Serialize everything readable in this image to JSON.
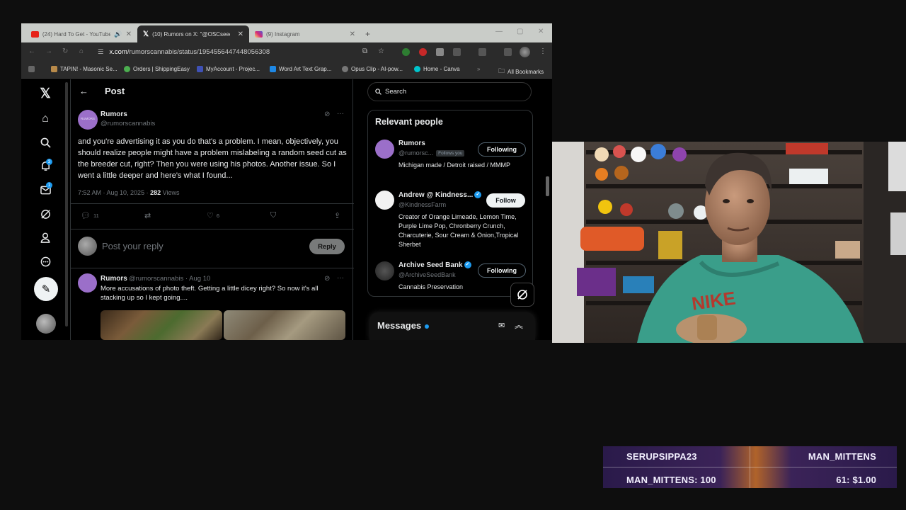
{
  "browser": {
    "tabs": [
      {
        "title": "(24) Hard To Get - YouTube",
        "favicon_color": "#e62117"
      },
      {
        "title": "(10) Rumors on X: \"@OSCseeds",
        "favicon_color": "#000000"
      },
      {
        "title": "(9) Instagram",
        "favicon_color": "#d6249f"
      }
    ],
    "new_tab_label": "+",
    "url_host": "x.com",
    "url_path": "/rumorscannabis/status/1954556447448056308",
    "bookmarks": [
      {
        "label": "TAPIN! - Masonic Se...",
        "color": "#b88a4a"
      },
      {
        "label": "Orders | ShippingEasy",
        "color": "#4caf50"
      },
      {
        "label": "MyAccount - Projec...",
        "color": "#3f51b5"
      },
      {
        "label": "Word Art Text Grap...",
        "color": "#1e88e5"
      },
      {
        "label": "Opus Clip - AI-pow...",
        "color": "#777777"
      },
      {
        "label": "Home - Canva",
        "color": "#00c4cc"
      }
    ],
    "bookmarks_overflow": "»",
    "all_bookmarks": "All Bookmarks"
  },
  "x": {
    "nav": {
      "notifications_badge": "3",
      "messages_badge": "1"
    },
    "header": {
      "back": "←",
      "title": "Post"
    },
    "post": {
      "author": "Rumors",
      "handle": "@rumorscannabis",
      "avatar_text": "RUMORS",
      "text": "and you're advertising it as you do that's a problem. I mean, objectively, you should realize people might have a problem mislabeling a random seed cut as the breeder cut, right? Then you were using his photos. Another issue. So I went a little deeper and here's what I found...",
      "time": "7:52 AM · Aug 10, 2025 · ",
      "views_count": "282",
      "views_label": " Views",
      "replies": "11",
      "likes": "6"
    },
    "reply_box": {
      "placeholder": "Post your reply",
      "button": "Reply"
    },
    "reply": {
      "author": "Rumors",
      "handle_date": "@rumorscannabis · Aug 10",
      "text": "More accusations of photo theft. Getting a little dicey right? So now it's all stacking up so I kept going...."
    },
    "search": {
      "placeholder": "Search"
    },
    "relevant": {
      "title": "Relevant people",
      "people": [
        {
          "name": "Rumors",
          "handle": "@rumorsc...",
          "follows_you": "Follows you",
          "bio": "Michigan made / Detroit raised / MMMP",
          "button": "Following"
        },
        {
          "name": "Andrew @ Kindness...",
          "handle": "@KindnessFarm",
          "bio": "Creator of Orange Limeade, Lemon Time, Purple Lime Pop, Chronberry Crunch, Charcuterie, Sour Cream & Onion,Tropical Sherbet",
          "button": "Follow"
        },
        {
          "name": "Archive Seed Bank",
          "handle": "@ArchiveSeedBank",
          "bio": "Cannabis Preservation",
          "button": "Following"
        }
      ]
    },
    "messages": {
      "title": "Messages"
    }
  },
  "overlay": {
    "top_left": "SERUPSIPPA23",
    "top_right": "MAN_MITTENS",
    "bottom_left": "MAN_MITTENS: 100",
    "bottom_right": "61: $1.00"
  },
  "colors": {
    "x_blue": "#1d9bf0",
    "background": "#0e0e0e"
  }
}
